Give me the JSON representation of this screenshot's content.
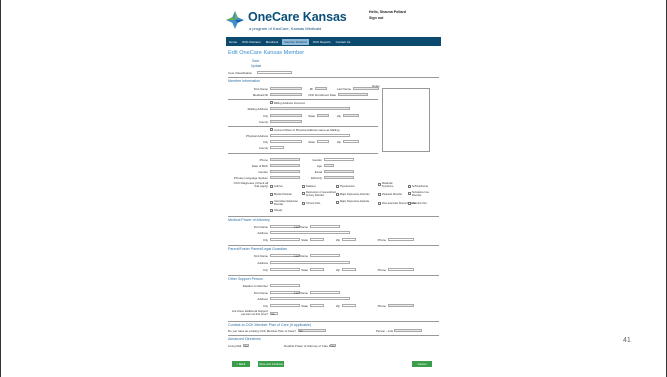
{
  "slide": {
    "number": "41"
  },
  "header": {
    "brand": "OneCare Kansas",
    "tagline": "a program of KanCare, Kansas Medicaid",
    "greeting": "Hello, Shauna Pollard",
    "signout": "Sign out"
  },
  "nav": {
    "items": [
      {
        "label": "Home",
        "active": false
      },
      {
        "label": "OCK Partners",
        "active": false
      },
      {
        "label": "Members",
        "active": false
      },
      {
        "label": "Member Referral",
        "active": true
      },
      {
        "label": "OCK Reports",
        "active": false
      },
      {
        "label": "Contact Us",
        "active": false
      }
    ]
  },
  "page": {
    "title": "Edit OneCare Kansas Member",
    "link_save": "Save",
    "link_update": "Update",
    "core_classification_label": "Core Classification"
  },
  "member_info": {
    "section": "Member Information",
    "first_name": "First Name",
    "mi": "MI",
    "last_name": "Last Name",
    "medicaid_id": "Medicaid ID",
    "ock_enrollment_date": "OCK Enrollment Date",
    "notes": "Notes",
    "billing_same": "Billing Address Incorrect",
    "mailing_address": "Mailing Address",
    "city": "City",
    "state": "State",
    "zip": "Zip",
    "county": "County",
    "physical_same": "Current Place of Physical Address same as Mailing",
    "physical_address": "Physical Address",
    "phone": "Phone",
    "gender": "Gender",
    "date_of_birth": "Date of Birth",
    "age": "Age",
    "email": "Email",
    "primary_language": "Primary Language Spoken",
    "ethnicity": "Ethnicity",
    "diagnosis_label": "OCK Diagnoses (Check all that apply)",
    "diagnoses": [
      "Asthma",
      "Diabetes",
      "Hypertension",
      "Metabolic Syndrome",
      "Schizophrenia",
      "Bipolar Disorder",
      "Depression or Generalized Anxiety Disorder",
      "Major Depressive Disorder",
      "Paranoid Disorder",
      "Substance Use Disorder",
      "Intermittent Explosive Disorder",
      "Chronic Pain",
      "Major Depressive Episode",
      "Post-traumatic Stress Disorder",
      "Attention Def.",
      "Obesity"
    ]
  },
  "medical_poa": {
    "section": "Medical Power of Attorney",
    "first_name": "First Name",
    "last_name": "Last Name",
    "address": "Address",
    "city": "City",
    "state": "State",
    "zip": "Zip",
    "phone": "Phone"
  },
  "guardian": {
    "section": "Parent/Foster Parent/Legal Guardian",
    "first_name": "First Name",
    "last_name": "Last Name",
    "address": "Address",
    "city": "City",
    "state": "State",
    "zip": "Zip",
    "phone": "Phone"
  },
  "support": {
    "section": "Other Support Person",
    "relation": "Relation to Member",
    "first_name": "First Name",
    "last_name": "Last Name",
    "address": "Address",
    "city": "City",
    "state": "State",
    "zip": "Zip",
    "phone": "Phone",
    "additional_q": "Are there additional Support persons at this time?",
    "additional_value": "No"
  },
  "outreach": {
    "section": "Contact-to-OCK Member Plan of Care (if applicable)",
    "prior_label": "Do you have an existing OCK Member Plan of Care?",
    "prior_value": "No",
    "plan_label": "Person - Link"
  },
  "advance": {
    "section": "Advanced Directives",
    "living_will": "Living Will",
    "living_will_value": "No",
    "dpoa": "Durable Power of Attorney of Care Plan",
    "dpoa_value": "No"
  },
  "buttons": {
    "back": "< Back",
    "save_continue": "Save and Continue",
    "cancel": "Cancel"
  },
  "colors": {
    "nav_bg": "#0b4a6e",
    "brand": "#0a4f7a",
    "button": "#3a9e4a",
    "section": "#2f6ea3"
  }
}
